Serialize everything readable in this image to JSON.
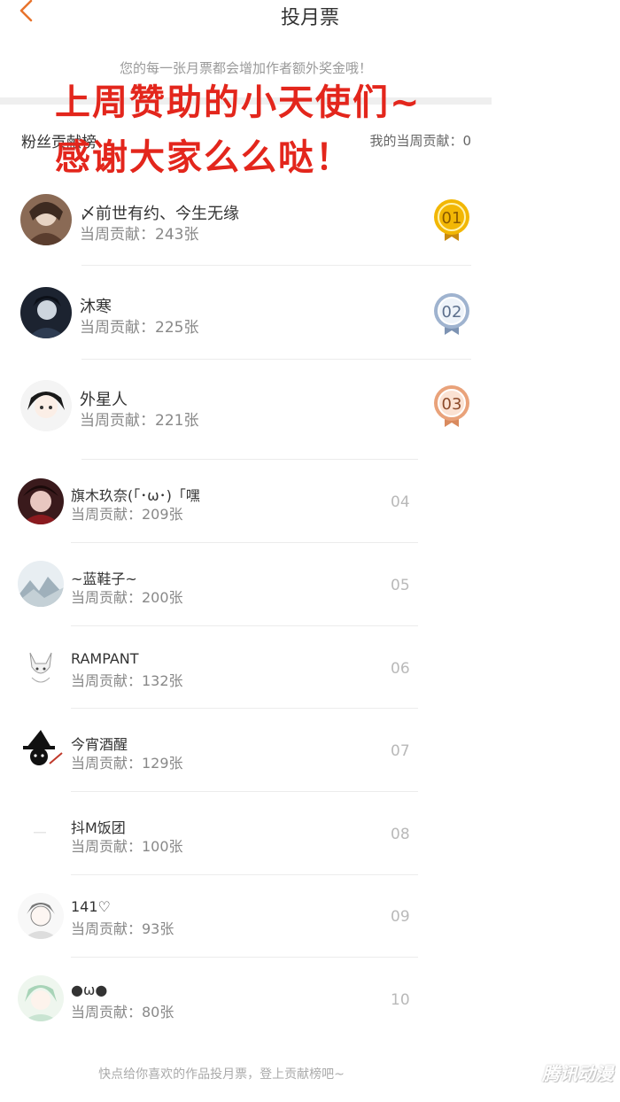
{
  "header": {
    "title": "投月票"
  },
  "subtitle": "您的每一张月票都会增加作者额外奖金哦！",
  "section": {
    "title": "粉丝贡献榜",
    "my_contribution": "我的当周贡献：0"
  },
  "overlay": {
    "line1": "上周赞助的小天使们~",
    "line2": "感谢大家么么哒！"
  },
  "ranking": [
    {
      "rank": "01",
      "name": "〆前世有约、今生无缘",
      "count": "当周贡献：243张",
      "medal": "gold"
    },
    {
      "rank": "02",
      "name": "沐寒",
      "count": "当周贡献：225张",
      "medal": "silver"
    },
    {
      "rank": "03",
      "name": "外星人",
      "count": "当周贡献：221张",
      "medal": "bronze"
    },
    {
      "rank": "04",
      "name": "旗木玖奈(「･ω･)「嘿",
      "count": "当周贡献：209张"
    },
    {
      "rank": "05",
      "name": "~蓝鞋子~",
      "count": "当周贡献：200张"
    },
    {
      "rank": "06",
      "name": "RAMPANT",
      "count": "当周贡献：132张"
    },
    {
      "rank": "07",
      "name": "今宵酒醒",
      "count": "当周贡献：129张"
    },
    {
      "rank": "08",
      "name": "抖M饭团",
      "count": "当周贡献：100张"
    },
    {
      "rank": "09",
      "name": "141♡",
      "count": "当周贡献：93张"
    },
    {
      "rank": "10",
      "name": "●ω●",
      "count": "当周贡献：80张"
    }
  ],
  "footer": {
    "text": "快点给你喜欢的作品投月票，登上贡献榜吧~"
  },
  "watermark": "腾讯动漫",
  "colors": {
    "accent": "#e8732c",
    "overlay": "#e3261c",
    "gold": "#f2b705",
    "silver": "#9fb3cf",
    "bronze": "#e9a27a"
  }
}
